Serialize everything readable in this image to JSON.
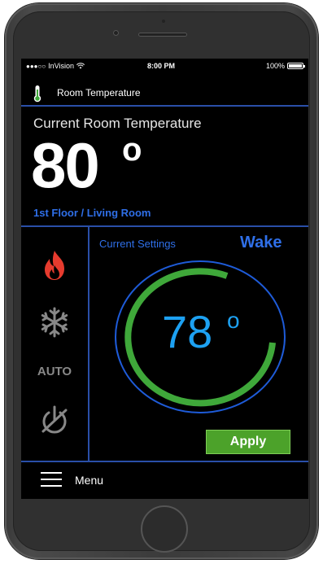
{
  "status": {
    "carrier": "InVision",
    "signal_dots": "●●●○○",
    "time": "8:00 PM",
    "battery": "100%",
    "battery_level": 1.0
  },
  "header": {
    "title": "Room Temperature",
    "icon": "thermometer-icon"
  },
  "current": {
    "label": "Current Room Temperature",
    "temperature": "80",
    "degree": "o",
    "location": "1st Floor / Living Room"
  },
  "modes": [
    {
      "name": "heat",
      "icon": "flame-icon",
      "active": true
    },
    {
      "name": "cool",
      "icon": "snowflake-icon",
      "active": false
    },
    {
      "name": "auto",
      "label": "AUTO",
      "active": false
    },
    {
      "name": "off",
      "icon": "power-off-icon",
      "active": false
    }
  ],
  "settings": {
    "label": "Current Settings",
    "schedule": "Wake",
    "target": "78",
    "degree": "o",
    "apply_label": "Apply"
  },
  "menu": {
    "label": "Menu",
    "icon": "hamburger-icon"
  },
  "colors": {
    "accent_blue": "#2f6fe8",
    "dial_green": "#3fa83a",
    "dial_ring": "#1e5bd8",
    "target_text": "#1da1f2",
    "apply_green": "#4ca22a",
    "flame_red": "#e63b2e",
    "inactive_gray": "#888888"
  }
}
